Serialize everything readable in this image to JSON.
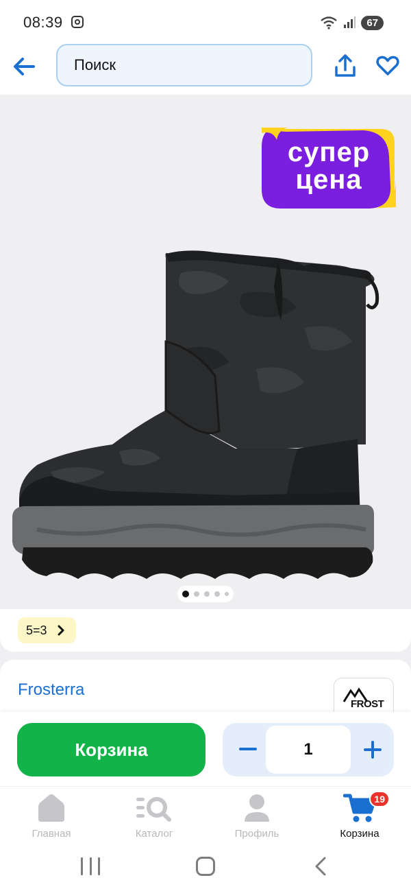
{
  "status_bar": {
    "time": "08:39",
    "battery": "67",
    "icons": [
      "instagram-icon",
      "wifi-icon",
      "signal-icon"
    ]
  },
  "header": {
    "search_placeholder": "Поиск",
    "icons": [
      "back-arrow-icon",
      "share-icon",
      "heart-icon"
    ]
  },
  "gallery": {
    "promo_badge": {
      "line1": "супер",
      "line2": "цена",
      "colors": {
        "background": "#7a1fe0",
        "accent": "#ffd21e"
      }
    },
    "dot_count": 5,
    "active_index": 0
  },
  "promo_chip": {
    "label": "5=3"
  },
  "product": {
    "brand": "Frosterra",
    "brand_logo_text": "FROST"
  },
  "actions": {
    "cart_button": "Корзина",
    "quantity": "1",
    "colors": {
      "cart": "#12b44a",
      "stepper_accent": "#1a6fd1"
    }
  },
  "tab_bar": {
    "tabs": [
      {
        "label": "Главная",
        "icon": "home-icon",
        "active": false
      },
      {
        "label": "Каталог",
        "icon": "catalog-search-icon",
        "active": false
      },
      {
        "label": "Профиль",
        "icon": "profile-icon",
        "active": false
      },
      {
        "label": "Корзина",
        "icon": "cart-icon",
        "active": true,
        "badge": "19"
      }
    ]
  }
}
